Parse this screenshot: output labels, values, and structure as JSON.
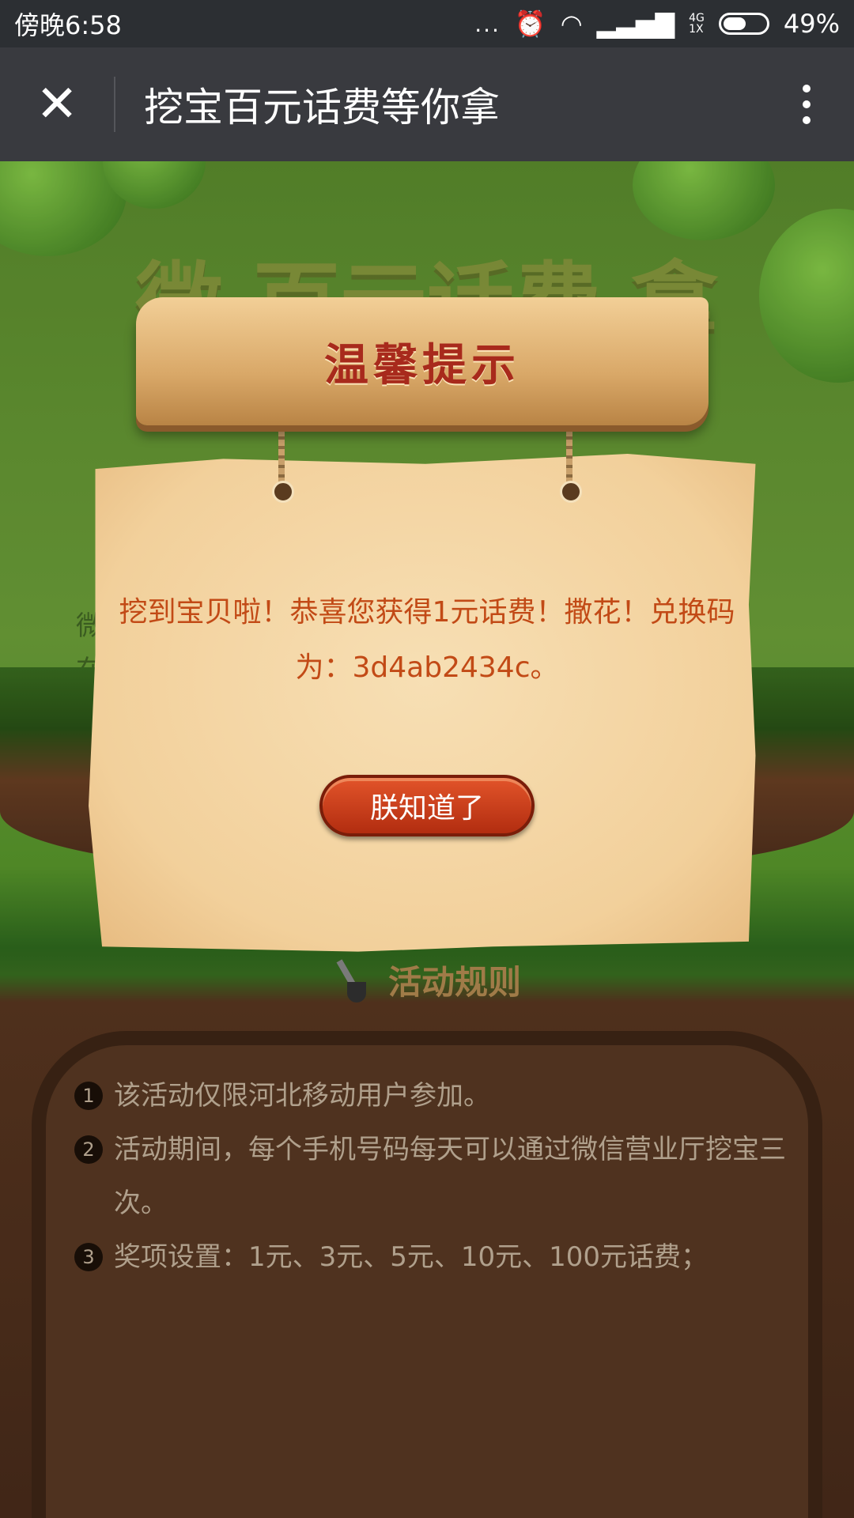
{
  "status_bar": {
    "time": "傍晚6:58",
    "dots": "...",
    "network_top": "4G",
    "network_bottom": "1X",
    "battery": "49%"
  },
  "title_bar": {
    "title": "挖宝百元话费等你拿"
  },
  "modal": {
    "header": "温馨提示",
    "message": "挖到宝贝啦！恭喜您获得1元话费！撒花！兑换码为：3d4ab2434c。",
    "button_label": "朕知道了"
  },
  "background": {
    "faded_title": "微 百元话费 拿",
    "faded_line1": "微",
    "faded_line2": "在"
  },
  "rules": {
    "title": "活动规则",
    "items": [
      {
        "num": "1",
        "text": "该活动仅限河北移动用户参加。"
      },
      {
        "num": "2",
        "text": "活动期间，每个手机号码每天可以通过微信营业厅挖宝三次。"
      },
      {
        "num": "3",
        "text": "奖项设置：1元、3元、5元、10元、100元话费；"
      }
    ]
  }
}
